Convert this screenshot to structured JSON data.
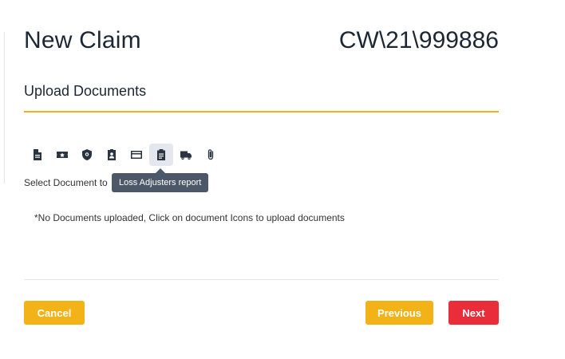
{
  "header": {
    "title": "New Claim",
    "claim_number": "CW\\21\\999886"
  },
  "section": {
    "title": "Upload Documents"
  },
  "toolbar": {
    "icons": [
      {
        "name": "document-icon"
      },
      {
        "name": "ticket-icon"
      },
      {
        "name": "shield-icon"
      },
      {
        "name": "id-badge-icon"
      },
      {
        "name": "credit-card-icon"
      },
      {
        "name": "clipboard-icon",
        "active": true
      },
      {
        "name": "truck-icon"
      },
      {
        "name": "paperclip-icon"
      }
    ],
    "tooltip": "Loss Adjusters report"
  },
  "select_label": "Select Document to",
  "empty_message": "*No Documents uploaded, Click on document Icons to upload documents",
  "buttons": {
    "cancel": "Cancel",
    "previous": "Previous",
    "next": "Next"
  },
  "colors": {
    "accent_yellow": "#f2b218",
    "next_red": "#ea2d3b",
    "tooltip_bg": "#4c5868"
  }
}
